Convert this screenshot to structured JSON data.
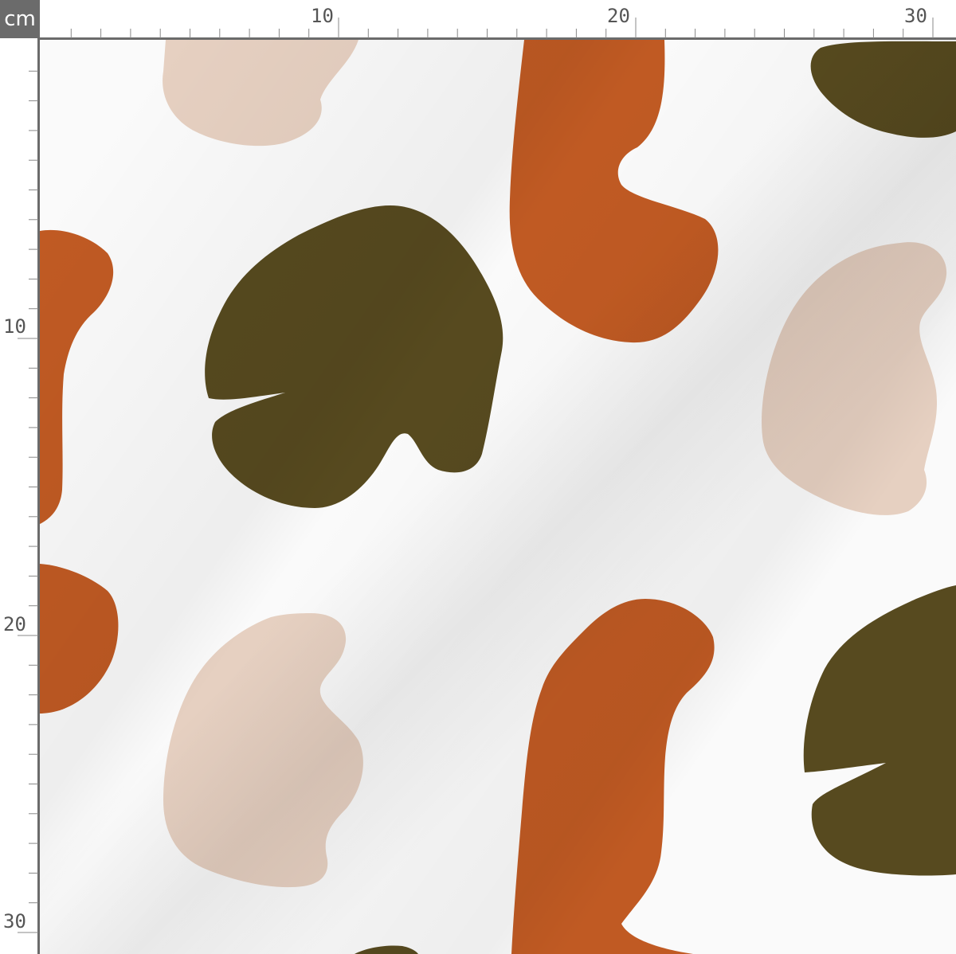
{
  "ruler": {
    "unit": "cm",
    "top_labels": [
      "10",
      "20",
      "30"
    ],
    "left_labels": [
      "10",
      "20",
      "30"
    ]
  },
  "fabric": {
    "background": "#fafafa",
    "colors": {
      "rust": "#c05a23",
      "olive": "#574a1f",
      "blush": "#e6d0c1"
    },
    "shapes": [
      {
        "name": "blush-blob-top-left",
        "color": "blush"
      },
      {
        "name": "rust-blob-top-center",
        "color": "rust"
      },
      {
        "name": "olive-blob-top-right",
        "color": "olive"
      },
      {
        "name": "rust-blob-left-upper",
        "color": "rust"
      },
      {
        "name": "olive-blob-center",
        "color": "olive"
      },
      {
        "name": "blush-blob-right",
        "color": "blush"
      },
      {
        "name": "rust-blob-left-lower",
        "color": "rust"
      },
      {
        "name": "blush-blob-bottom-left",
        "color": "blush"
      },
      {
        "name": "rust-blob-bottom-center",
        "color": "rust"
      },
      {
        "name": "olive-blob-bottom-right",
        "color": "olive"
      },
      {
        "name": "olive-blob-bottom-edge",
        "color": "olive"
      }
    ]
  }
}
